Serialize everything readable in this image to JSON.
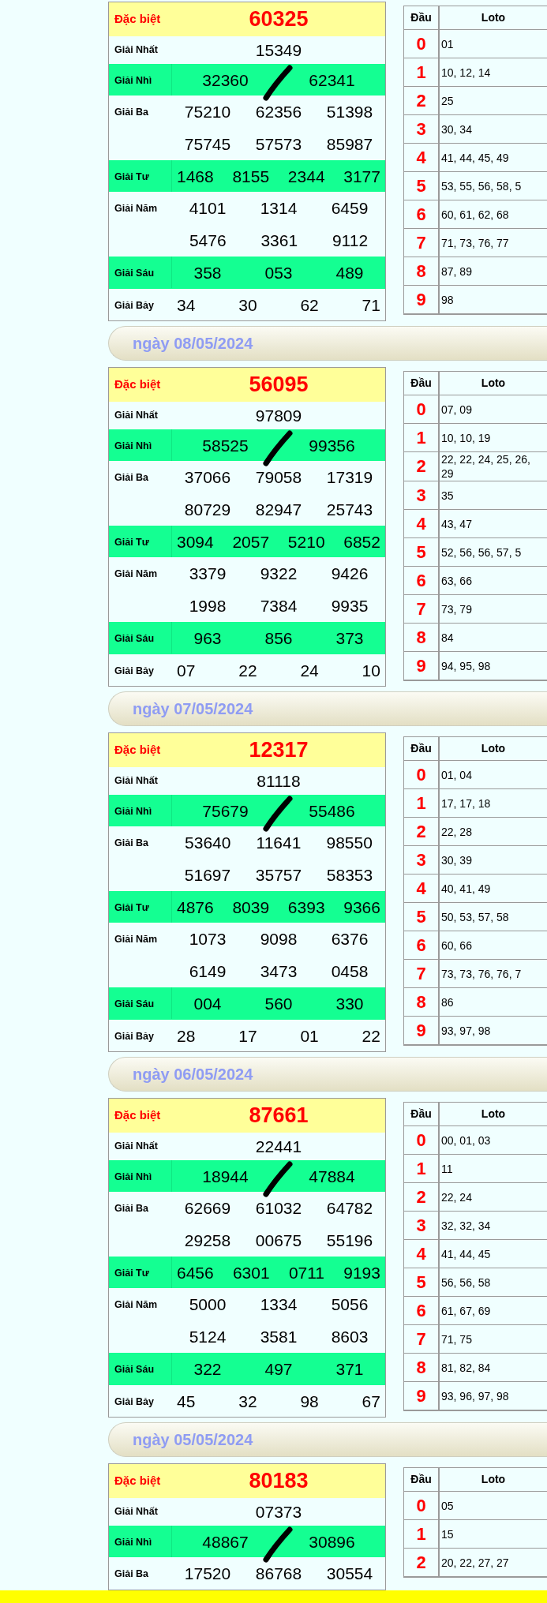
{
  "days": [
    {
      "prizes": [
        {
          "label": "Đặc biệt",
          "kind": "special",
          "lines": [
            [
              "60325"
            ]
          ]
        },
        {
          "label": "Giải Nhất",
          "kind": "plain",
          "lines": [
            [
              "15349"
            ]
          ]
        },
        {
          "label": "Giải Nhì",
          "kind": "green",
          "lines": [
            [
              "32360",
              "62341"
            ]
          ]
        },
        {
          "label": "Giải Ba",
          "kind": "plain",
          "lines": [
            [
              "75210",
              "62356",
              "51398"
            ],
            [
              "75745",
              "57573",
              "85987"
            ]
          ]
        },
        {
          "label": "Giải Tư",
          "kind": "green",
          "lines": [
            [
              "1468",
              "8155",
              "2344",
              "3177"
            ]
          ]
        },
        {
          "label": "Giải Năm",
          "kind": "plain",
          "lines": [
            [
              "4101",
              "1314",
              "6459"
            ],
            [
              "5476",
              "3361",
              "9112"
            ]
          ]
        },
        {
          "label": "Giải Sáu",
          "kind": "green",
          "lines": [
            [
              "358",
              "053",
              "489"
            ]
          ]
        },
        {
          "label": "Giải Bảy",
          "kind": "plain",
          "lines": [
            [
              "34",
              "30",
              "62",
              "71"
            ]
          ]
        }
      ],
      "loto": {
        "columns": [
          "Đầu",
          "Loto"
        ],
        "rows": [
          {
            "head": "0",
            "values": "01"
          },
          {
            "head": "1",
            "values": "10, 12, 14"
          },
          {
            "head": "2",
            "values": "25"
          },
          {
            "head": "3",
            "values": "30, 34"
          },
          {
            "head": "4",
            "values": "41, 44, 45, 49"
          },
          {
            "head": "5",
            "values": "53, 55, 56, 58, 5"
          },
          {
            "head": "6",
            "values": "60, 61, 62, 68"
          },
          {
            "head": "7",
            "values": "71, 73, 76, 77"
          },
          {
            "head": "8",
            "values": "87, 89"
          },
          {
            "head": "9",
            "values": "98"
          }
        ]
      }
    },
    {
      "date": "ngày 08/05/2024",
      "prizes": [
        {
          "label": "Đặc biệt",
          "kind": "special",
          "lines": [
            [
              "56095"
            ]
          ]
        },
        {
          "label": "Giải Nhất",
          "kind": "plain",
          "lines": [
            [
              "97809"
            ]
          ]
        },
        {
          "label": "Giải Nhì",
          "kind": "green",
          "lines": [
            [
              "58525",
              "99356"
            ]
          ]
        },
        {
          "label": "Giải Ba",
          "kind": "plain",
          "lines": [
            [
              "37066",
              "79058",
              "17319"
            ],
            [
              "80729",
              "82947",
              "25743"
            ]
          ]
        },
        {
          "label": "Giải Tư",
          "kind": "green",
          "lines": [
            [
              "3094",
              "2057",
              "5210",
              "6852"
            ]
          ]
        },
        {
          "label": "Giải Năm",
          "kind": "plain",
          "lines": [
            [
              "3379",
              "9322",
              "9426"
            ],
            [
              "1998",
              "7384",
              "9935"
            ]
          ]
        },
        {
          "label": "Giải Sáu",
          "kind": "green",
          "lines": [
            [
              "963",
              "856",
              "373"
            ]
          ]
        },
        {
          "label": "Giải Bảy",
          "kind": "plain",
          "lines": [
            [
              "07",
              "22",
              "24",
              "10"
            ]
          ]
        }
      ],
      "loto": {
        "columns": [
          "Đầu",
          "Loto"
        ],
        "rows": [
          {
            "head": "0",
            "values": "07, 09"
          },
          {
            "head": "1",
            "values": "10, 10, 19"
          },
          {
            "head": "2",
            "values": "22, 22, 24, 25, 26, 29"
          },
          {
            "head": "3",
            "values": "35"
          },
          {
            "head": "4",
            "values": "43, 47"
          },
          {
            "head": "5",
            "values": "52, 56, 56, 57, 5"
          },
          {
            "head": "6",
            "values": "63, 66"
          },
          {
            "head": "7",
            "values": "73, 79"
          },
          {
            "head": "8",
            "values": "84"
          },
          {
            "head": "9",
            "values": "94, 95, 98"
          }
        ]
      }
    },
    {
      "date": "ngày 07/05/2024",
      "prizes": [
        {
          "label": "Đặc biệt",
          "kind": "special",
          "lines": [
            [
              "12317"
            ]
          ]
        },
        {
          "label": "Giải Nhất",
          "kind": "plain",
          "lines": [
            [
              "81118"
            ]
          ]
        },
        {
          "label": "Giải Nhì",
          "kind": "green",
          "lines": [
            [
              "75679",
              "55486"
            ]
          ]
        },
        {
          "label": "Giải Ba",
          "kind": "plain",
          "lines": [
            [
              "53640",
              "11641",
              "98550"
            ],
            [
              "51697",
              "35757",
              "58353"
            ]
          ]
        },
        {
          "label": "Giải Tư",
          "kind": "green",
          "lines": [
            [
              "4876",
              "8039",
              "6393",
              "9366"
            ]
          ]
        },
        {
          "label": "Giải Năm",
          "kind": "plain",
          "lines": [
            [
              "1073",
              "9098",
              "6376"
            ],
            [
              "6149",
              "3473",
              "0458"
            ]
          ]
        },
        {
          "label": "Giải Sáu",
          "kind": "green",
          "lines": [
            [
              "004",
              "560",
              "330"
            ]
          ]
        },
        {
          "label": "Giải Bảy",
          "kind": "plain",
          "lines": [
            [
              "28",
              "17",
              "01",
              "22"
            ]
          ]
        }
      ],
      "loto": {
        "columns": [
          "Đầu",
          "Loto"
        ],
        "rows": [
          {
            "head": "0",
            "values": "01, 04"
          },
          {
            "head": "1",
            "values": "17, 17, 18"
          },
          {
            "head": "2",
            "values": "22, 28"
          },
          {
            "head": "3",
            "values": "30, 39"
          },
          {
            "head": "4",
            "values": "40, 41, 49"
          },
          {
            "head": "5",
            "values": "50, 53, 57, 58"
          },
          {
            "head": "6",
            "values": "60, 66"
          },
          {
            "head": "7",
            "values": "73, 73, 76, 76, 7"
          },
          {
            "head": "8",
            "values": "86"
          },
          {
            "head": "9",
            "values": "93, 97, 98"
          }
        ]
      }
    },
    {
      "date": "ngày 06/05/2024",
      "prizes": [
        {
          "label": "Đặc biệt",
          "kind": "special",
          "lines": [
            [
              "87661"
            ]
          ]
        },
        {
          "label": "Giải Nhất",
          "kind": "plain",
          "lines": [
            [
              "22441"
            ]
          ]
        },
        {
          "label": "Giải Nhì",
          "kind": "green",
          "lines": [
            [
              "18944",
              "47884"
            ]
          ]
        },
        {
          "label": "Giải Ba",
          "kind": "plain",
          "lines": [
            [
              "62669",
              "61032",
              "64782"
            ],
            [
              "29258",
              "00675",
              "55196"
            ]
          ]
        },
        {
          "label": "Giải Tư",
          "kind": "green",
          "lines": [
            [
              "6456",
              "6301",
              "0711",
              "9193"
            ]
          ]
        },
        {
          "label": "Giải Năm",
          "kind": "plain",
          "lines": [
            [
              "5000",
              "1334",
              "5056"
            ],
            [
              "5124",
              "3581",
              "8603"
            ]
          ]
        },
        {
          "label": "Giải Sáu",
          "kind": "green",
          "lines": [
            [
              "322",
              "497",
              "371"
            ]
          ]
        },
        {
          "label": "Giải Bảy",
          "kind": "plain",
          "lines": [
            [
              "45",
              "32",
              "98",
              "67"
            ]
          ]
        }
      ],
      "loto": {
        "columns": [
          "Đầu",
          "Loto"
        ],
        "rows": [
          {
            "head": "0",
            "values": "00, 01, 03"
          },
          {
            "head": "1",
            "values": "11"
          },
          {
            "head": "2",
            "values": "22, 24"
          },
          {
            "head": "3",
            "values": "32, 32, 34"
          },
          {
            "head": "4",
            "values": "41, 44, 45"
          },
          {
            "head": "5",
            "values": "56, 56, 58"
          },
          {
            "head": "6",
            "values": "61, 67, 69"
          },
          {
            "head": "7",
            "values": "71, 75"
          },
          {
            "head": "8",
            "values": "81, 82, 84"
          },
          {
            "head": "9",
            "values": "93, 96, 97, 98"
          }
        ]
      }
    },
    {
      "date": "ngày 05/05/2024",
      "prizes": [
        {
          "label": "Đặc biệt",
          "kind": "special",
          "lines": [
            [
              "80183"
            ]
          ]
        },
        {
          "label": "Giải Nhất",
          "kind": "plain",
          "lines": [
            [
              "07373"
            ]
          ]
        },
        {
          "label": "Giải Nhì",
          "kind": "green",
          "lines": [
            [
              "48867",
              "30896"
            ]
          ]
        },
        {
          "label": "Giải Ba",
          "kind": "plain",
          "lines": [
            [
              "17520",
              "86768",
              "30554"
            ]
          ]
        }
      ],
      "loto": {
        "columns": [
          "Đầu",
          "Loto"
        ],
        "rows": [
          {
            "head": "0",
            "values": "05"
          },
          {
            "head": "1",
            "values": "15"
          },
          {
            "head": "2",
            "values": "20, 22, 27, 27"
          }
        ]
      }
    }
  ]
}
